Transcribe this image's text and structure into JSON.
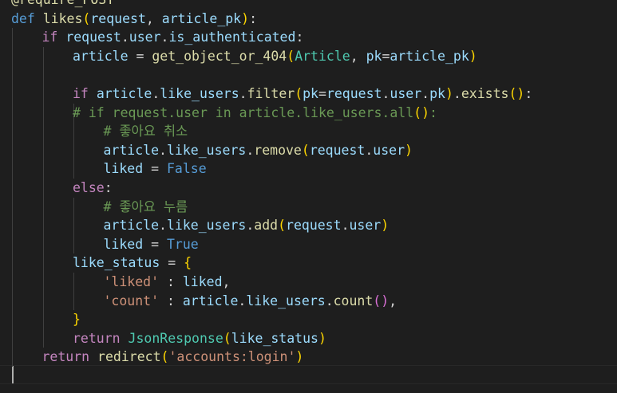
{
  "colors": {
    "keyword": "#569cd6",
    "control": "#c586c0",
    "function": "#dcdcaa",
    "variable": "#9cdcfe",
    "class": "#4ec9b0",
    "string": "#ce9178",
    "comment": "#6a9955",
    "bracket1": "#ffd700",
    "bracket2": "#da70d6",
    "text": "#d4d4d4"
  },
  "lines": [
    {
      "indent": 0,
      "tokens": [
        [
          "@require_POST",
          "function"
        ]
      ]
    },
    {
      "indent": 0,
      "tokens": [
        [
          "def",
          "keyword"
        ],
        [
          " ",
          "text"
        ],
        [
          "likes",
          "function"
        ],
        [
          "(",
          "bracket1"
        ],
        [
          "request",
          "variable"
        ],
        [
          ", ",
          "text"
        ],
        [
          "article_pk",
          "variable"
        ],
        [
          ")",
          "bracket1"
        ],
        [
          ":",
          "text"
        ]
      ]
    },
    {
      "indent": 1,
      "tokens": [
        [
          "if",
          "control"
        ],
        [
          " ",
          "text"
        ],
        [
          "request",
          "variable"
        ],
        [
          ".",
          "text"
        ],
        [
          "user",
          "variable"
        ],
        [
          ".",
          "text"
        ],
        [
          "is_authenticated",
          "variable"
        ],
        [
          ":",
          "text"
        ]
      ]
    },
    {
      "indent": 2,
      "tokens": [
        [
          "article",
          "variable"
        ],
        [
          " = ",
          "text"
        ],
        [
          "get_object_or_404",
          "function"
        ],
        [
          "(",
          "bracket1"
        ],
        [
          "Article",
          "class"
        ],
        [
          ", ",
          "text"
        ],
        [
          "pk",
          "variable"
        ],
        [
          "=",
          "text"
        ],
        [
          "article_pk",
          "variable"
        ],
        [
          ")",
          "bracket1"
        ]
      ]
    },
    {
      "indent": 2,
      "tokens": []
    },
    {
      "indent": 2,
      "tokens": [
        [
          "if",
          "control"
        ],
        [
          " ",
          "text"
        ],
        [
          "article",
          "variable"
        ],
        [
          ".",
          "text"
        ],
        [
          "like_users",
          "variable"
        ],
        [
          ".",
          "text"
        ],
        [
          "filter",
          "function"
        ],
        [
          "(",
          "bracket1"
        ],
        [
          "pk",
          "variable"
        ],
        [
          "=",
          "text"
        ],
        [
          "request",
          "variable"
        ],
        [
          ".",
          "text"
        ],
        [
          "user",
          "variable"
        ],
        [
          ".",
          "text"
        ],
        [
          "pk",
          "variable"
        ],
        [
          ")",
          "bracket1"
        ],
        [
          ".",
          "text"
        ],
        [
          "exists",
          "function"
        ],
        [
          "(",
          "bracket1"
        ],
        [
          ")",
          "bracket1"
        ],
        [
          ":",
          "text"
        ]
      ]
    },
    {
      "indent": 2,
      "tokens": [
        [
          "# if request.user in article.like_users.all",
          "comment"
        ],
        [
          "(",
          "bracket1"
        ],
        [
          ")",
          "bracket1"
        ],
        [
          ":",
          "comment"
        ]
      ]
    },
    {
      "indent": 3,
      "tokens": [
        [
          "# 좋아요 취소",
          "comment"
        ]
      ]
    },
    {
      "indent": 3,
      "tokens": [
        [
          "article",
          "variable"
        ],
        [
          ".",
          "text"
        ],
        [
          "like_users",
          "variable"
        ],
        [
          ".",
          "text"
        ],
        [
          "remove",
          "function"
        ],
        [
          "(",
          "bracket1"
        ],
        [
          "request",
          "variable"
        ],
        [
          ".",
          "text"
        ],
        [
          "user",
          "variable"
        ],
        [
          ")",
          "bracket1"
        ]
      ]
    },
    {
      "indent": 3,
      "tokens": [
        [
          "liked",
          "variable"
        ],
        [
          " = ",
          "text"
        ],
        [
          "False",
          "keyword"
        ]
      ]
    },
    {
      "indent": 2,
      "tokens": [
        [
          "else",
          "control"
        ],
        [
          ":",
          "text"
        ]
      ]
    },
    {
      "indent": 3,
      "tokens": [
        [
          "# 좋아요 누름",
          "comment"
        ]
      ]
    },
    {
      "indent": 3,
      "tokens": [
        [
          "article",
          "variable"
        ],
        [
          ".",
          "text"
        ],
        [
          "like_users",
          "variable"
        ],
        [
          ".",
          "text"
        ],
        [
          "add",
          "function"
        ],
        [
          "(",
          "bracket1"
        ],
        [
          "request",
          "variable"
        ],
        [
          ".",
          "text"
        ],
        [
          "user",
          "variable"
        ],
        [
          ")",
          "bracket1"
        ]
      ]
    },
    {
      "indent": 3,
      "tokens": [
        [
          "liked",
          "variable"
        ],
        [
          " = ",
          "text"
        ],
        [
          "True",
          "keyword"
        ]
      ]
    },
    {
      "indent": 2,
      "tokens": [
        [
          "like_status",
          "variable"
        ],
        [
          " = ",
          "text"
        ],
        [
          "{",
          "bracket1"
        ]
      ]
    },
    {
      "indent": 3,
      "tokens": [
        [
          "'liked'",
          "string"
        ],
        [
          " : ",
          "text"
        ],
        [
          "liked",
          "variable"
        ],
        [
          ",",
          "text"
        ]
      ]
    },
    {
      "indent": 3,
      "tokens": [
        [
          "'count'",
          "string"
        ],
        [
          " : ",
          "text"
        ],
        [
          "article",
          "variable"
        ],
        [
          ".",
          "text"
        ],
        [
          "like_users",
          "variable"
        ],
        [
          ".",
          "text"
        ],
        [
          "count",
          "function"
        ],
        [
          "(",
          "bracket2"
        ],
        [
          ")",
          "bracket2"
        ],
        [
          ",",
          "text"
        ]
      ]
    },
    {
      "indent": 2,
      "tokens": [
        [
          "}",
          "bracket1"
        ]
      ]
    },
    {
      "indent": 2,
      "tokens": [
        [
          "return",
          "control"
        ],
        [
          " ",
          "text"
        ],
        [
          "JsonResponse",
          "class"
        ],
        [
          "(",
          "bracket1"
        ],
        [
          "like_status",
          "variable"
        ],
        [
          ")",
          "bracket1"
        ]
      ]
    },
    {
      "indent": 1,
      "tokens": [
        [
          "return",
          "control"
        ],
        [
          " ",
          "text"
        ],
        [
          "redirect",
          "function"
        ],
        [
          "(",
          "bracket1"
        ],
        [
          "'accounts:login'",
          "string"
        ],
        [
          ")",
          "bracket1"
        ]
      ]
    },
    {
      "indent": 0,
      "tokens": []
    }
  ]
}
